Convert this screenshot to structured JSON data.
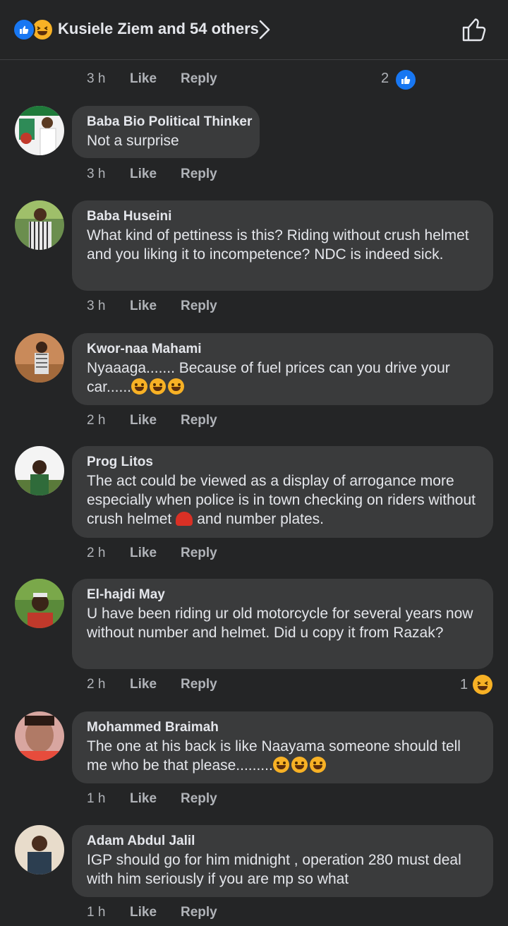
{
  "header": {
    "title": "Kusiele Ziem and 54 others",
    "reaction_icons": [
      "like-icon",
      "haha-icon"
    ]
  },
  "actions": {
    "like": "Like",
    "reply": "Reply"
  },
  "top_meta": {
    "time": "3 h",
    "reaction_count": "2",
    "reaction_icon": "like-icon"
  },
  "comments": [
    {
      "author": "Baba Bio Political Thinker",
      "text": "Not a surprise",
      "time": "3 h"
    },
    {
      "author": "Baba Huseini",
      "text": "What kind of pettiness is this? Riding without crush helmet and you liking it to incompetence? NDC is indeed sick.",
      "time": "3 h"
    },
    {
      "author": "Kwor-naa Mahami",
      "text": "Nyaaaga....... Because of fuel prices can you drive your car......",
      "emojis": [
        "laughing-tears-emoji",
        "laughing-tears-emoji",
        "laughing-tears-emoji"
      ],
      "time": "2 h"
    },
    {
      "author": "Prog Litos",
      "text_before": "The act could be viewed as a display of arrogance more especially when police is in town checking on riders without crush helmet",
      "text_after": "and number plates.",
      "inline_emoji": "helmet-emoji",
      "time": "2 h"
    },
    {
      "author": "El-hajdi May",
      "text": "U have been riding ur old motorcycle for several years now without number and helmet. Did u copy it from Razak?",
      "time": "2 h",
      "reaction_count": "1",
      "reaction_icon": "haha-icon"
    },
    {
      "author": "Mohammed Braimah",
      "text": "The one at his back is like Naayama someone should tell me who be that please.........",
      "emojis": [
        "grinning-emoji",
        "grinning-emoji",
        "grinning-emoji"
      ],
      "time": "1 h"
    },
    {
      "author": "Adam Abdul Jalil",
      "text": "IGP should go for him midnight , operation 280 must deal with him seriously if you are mp so what",
      "time": "1 h"
    }
  ]
}
